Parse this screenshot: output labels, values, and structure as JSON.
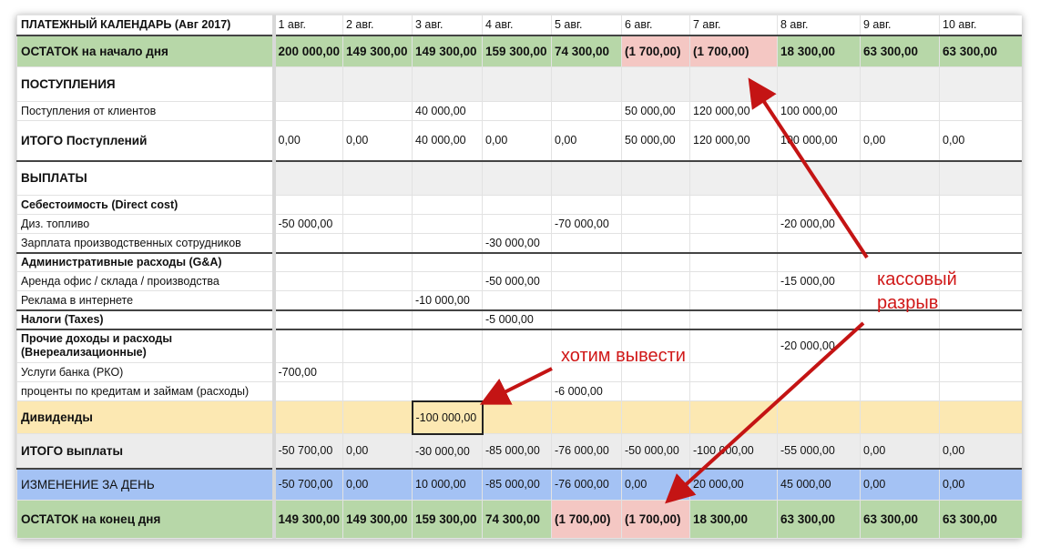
{
  "header": {
    "title": "ПЛАТЕЖНЫЙ КАЛЕНДАРЬ (Авг 2017)",
    "days": [
      "1 авг.",
      "2 авг.",
      "3 авг.",
      "4 авг.",
      "5 авг.",
      "6 авг.",
      "7 авг.",
      "8 авг.",
      "9 авг.",
      "10 авг."
    ]
  },
  "rows": {
    "start": {
      "label": "ОСТАТОК на начало дня",
      "values": [
        "200 000,00",
        "149 300,00",
        "149 300,00",
        "159 300,00",
        "74 300,00",
        "(1 700,00)",
        "(1 700,00)",
        "18 300,00",
        "63 300,00",
        "63 300,00"
      ]
    },
    "income_header": {
      "label": "ПОСТУПЛЕНИЯ"
    },
    "income_clients": {
      "label": "Поступления от клиентов",
      "values": [
        "",
        "",
        "40 000,00",
        "",
        "",
        "50 000,00",
        "120 000,00",
        "100 000,00",
        "",
        ""
      ]
    },
    "income_total": {
      "label": "ИТОГО Поступлений",
      "values": [
        "0,00",
        "0,00",
        "40 000,00",
        "0,00",
        "0,00",
        "50 000,00",
        "120 000,00",
        "100 000,00",
        "0,00",
        "0,00"
      ]
    },
    "pay_header": {
      "label": "ВЫПЛАТЫ"
    },
    "cost_header": {
      "label": "Себестоимость (Direct cost)"
    },
    "diesel": {
      "label": "Диз. топливо",
      "values": [
        "-50 000,00",
        "",
        "",
        "",
        "-70 000,00",
        "",
        "",
        "-20 000,00",
        "",
        ""
      ]
    },
    "salary": {
      "label": "Зарплата производственных сотрудников",
      "values": [
        "",
        "",
        "",
        "-30 000,00",
        "",
        "",
        "",
        "",
        "",
        ""
      ]
    },
    "ga_header": {
      "label": "Административные расходы (G&A)"
    },
    "rent": {
      "label": "Аренда офис / склада / производства",
      "values": [
        "",
        "",
        "",
        "-50 000,00",
        "",
        "",
        "",
        "-15 000,00",
        "",
        ""
      ]
    },
    "ads": {
      "label": "Реклама в интернете",
      "values": [
        "",
        "",
        "-10 000,00",
        "",
        "",
        "",
        "",
        "",
        "",
        ""
      ]
    },
    "taxes": {
      "label": "Налоги (Taxes)",
      "values": [
        "",
        "",
        "",
        "-5 000,00",
        "",
        "",
        "",
        "",
        "",
        ""
      ]
    },
    "other": {
      "label": "Прочие доходы и расходы (Внереализационные)",
      "values": [
        "",
        "",
        "",
        "",
        "",
        "",
        "",
        "-20 000,00",
        "",
        ""
      ]
    },
    "bank": {
      "label": "Услуги банка (РКО)",
      "values": [
        "-700,00",
        "",
        "",
        "",
        "",
        "",
        "",
        "",
        "",
        ""
      ]
    },
    "interest": {
      "label": "проценты по кредитам и займам (расходы)",
      "values": [
        "",
        "",
        "",
        "",
        "-6 000,00",
        "",
        "",
        "",
        "",
        ""
      ]
    },
    "dividends": {
      "label": "Дивиденды",
      "values": [
        "",
        "",
        "-100 000,00",
        "",
        "",
        "",
        "",
        "",
        "",
        ""
      ]
    },
    "pay_total": {
      "label": "ИТОГО выплаты",
      "values": [
        "-50 700,00",
        "0,00",
        "-30 000,00",
        "-85 000,00",
        "-76 000,00",
        "-50 000,00",
        "-100 000,00",
        "-55 000,00",
        "0,00",
        "0,00"
      ]
    },
    "change": {
      "label": "ИЗМЕНЕНИЕ ЗА ДЕНЬ",
      "values": [
        "-50 700,00",
        "0,00",
        "10 000,00",
        "-85 000,00",
        "-76 000,00",
        "0,00",
        "20 000,00",
        "45 000,00",
        "0,00",
        "0,00"
      ]
    },
    "end": {
      "label": "ОСТАТОК на конец дня",
      "values": [
        "149 300,00",
        "149 300,00",
        "159 300,00",
        "74 300,00",
        "(1 700,00)",
        "(1 700,00)",
        "18 300,00",
        "63 300,00",
        "63 300,00",
        "63 300,00"
      ]
    }
  },
  "annotations": {
    "cash_gap_line1": "кассовый",
    "cash_gap_line2": "разрыв",
    "want_withdraw": "хотим вывести"
  },
  "colors": {
    "balance_green": "#b7d7a8",
    "negative_red": "#f4c7c3",
    "dividends_yellow": "#fce8b2",
    "change_blue": "#a4c2f4",
    "arrow_red": "#d01818"
  }
}
